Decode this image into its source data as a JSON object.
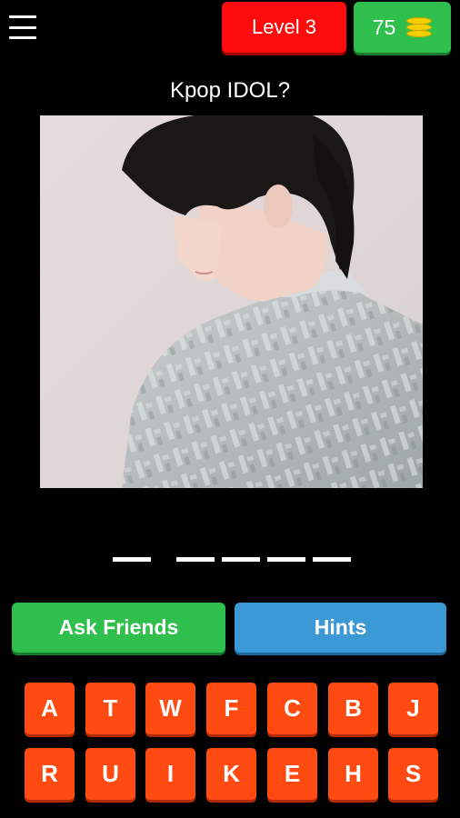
{
  "header": {
    "level_label": "Level 3",
    "coins": "75"
  },
  "question": "Kpop IDOL?",
  "answer_slots": {
    "word_lengths": [
      1,
      4
    ]
  },
  "buttons": {
    "ask_friends": "Ask Friends",
    "hints": "Hints"
  },
  "keyboard": {
    "row1": [
      "A",
      "T",
      "W",
      "F",
      "C",
      "B",
      "J"
    ],
    "row2": [
      "R",
      "U",
      "I",
      "K",
      "E",
      "H",
      "S"
    ]
  },
  "colors": {
    "level_badge": "#ff0b0b",
    "coins_badge": "#2fbf4c",
    "ask_friends": "#2fbf4c",
    "hints": "#3b9ad6",
    "key": "#ff4a12"
  }
}
